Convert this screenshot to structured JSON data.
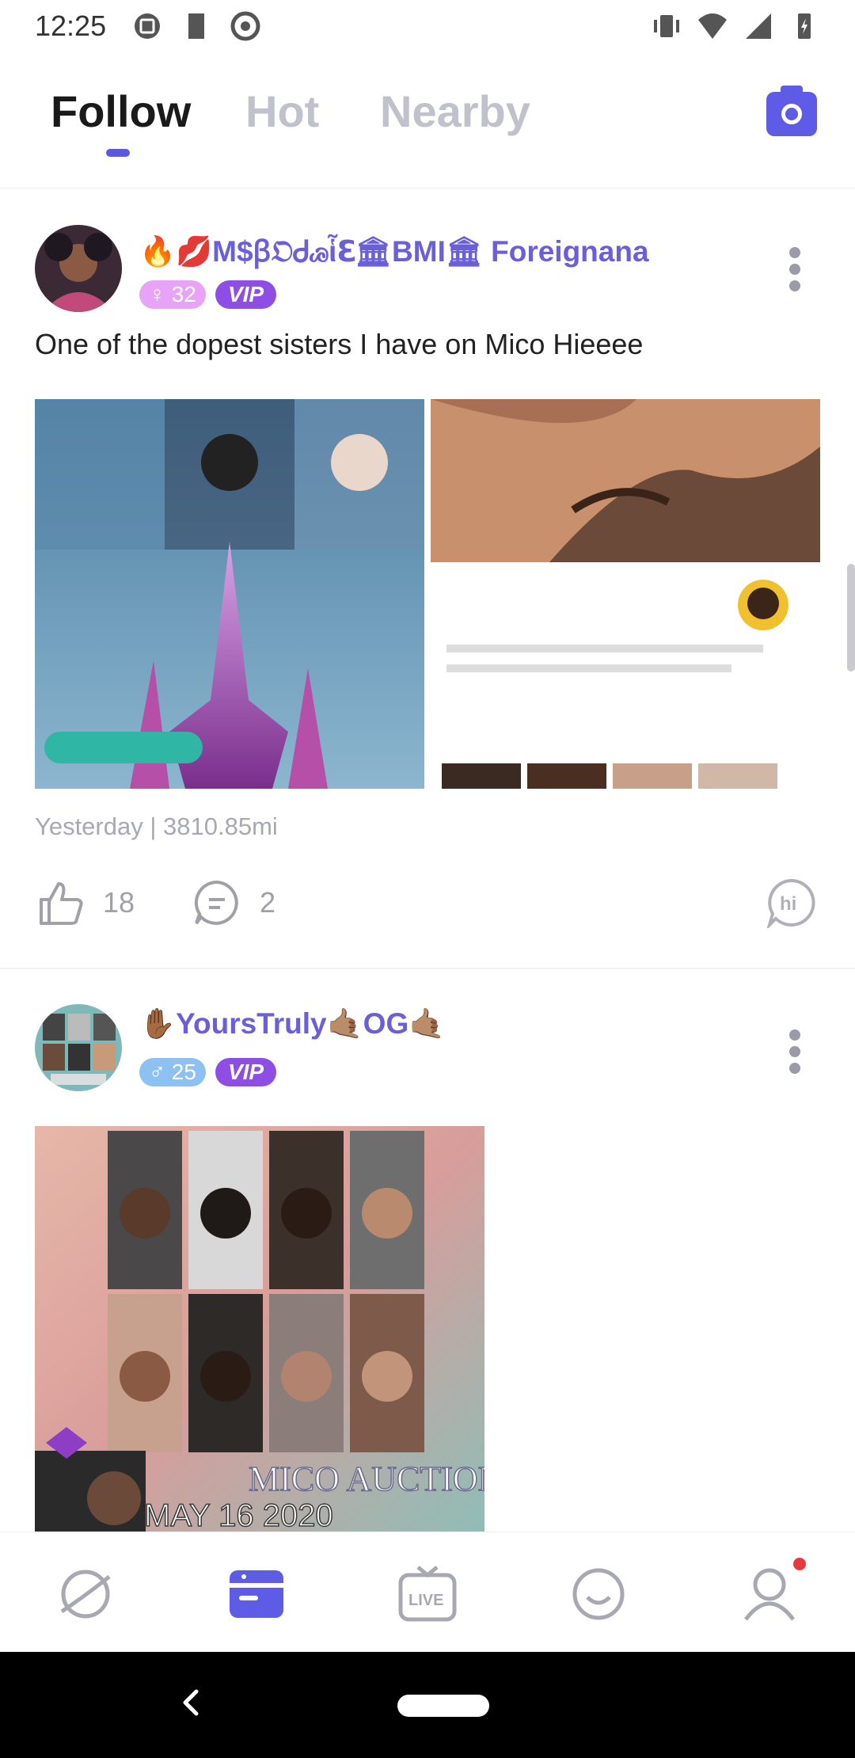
{
  "status_bar": {
    "time": "12:25"
  },
  "tabs": [
    {
      "label": "Follow",
      "active": true
    },
    {
      "label": "Hot",
      "active": false
    },
    {
      "label": "Nearby",
      "active": false
    }
  ],
  "accent_color": "#5e5ce6",
  "posts": [
    {
      "username": "🔥💋M$ꞵ𝔒Ꮷꮚἷℇ🏛BMI🏛 Foreignana",
      "gender_badge": "♀ 32",
      "vip_badge": "VIP",
      "text": "One of the dopest sisters I have on Mico   Hieeee",
      "meta": "Yesterday | 3810.85mi",
      "likes": "18",
      "comments": "2"
    },
    {
      "username": "✋🏾YoursTruly🤙🏽OG🤙🏽",
      "gender_badge": "♂ 25",
      "vip_badge": "VIP",
      "image_caption": "MICO AUCTION",
      "image_date": "MAY 16 2020"
    }
  ],
  "bottom_nav": [
    "explore-icon",
    "feed-icon",
    "live-icon",
    "chat-icon",
    "profile-icon"
  ],
  "live_label": "LIVE"
}
